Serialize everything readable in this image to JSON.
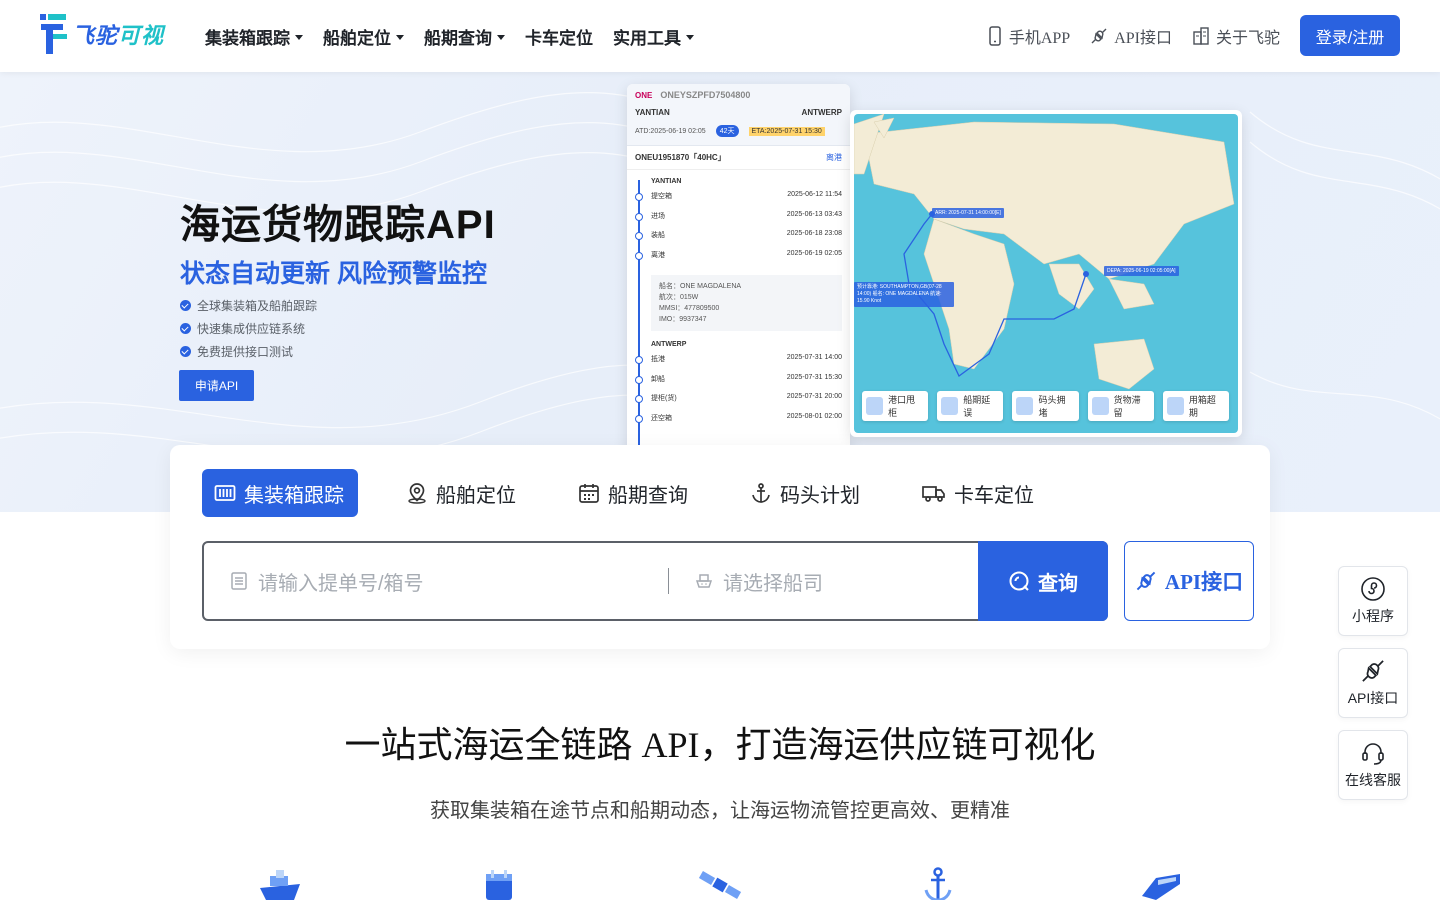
{
  "brand": {
    "logo_text_a": "飞驼",
    "logo_text_b": "可视"
  },
  "nav": {
    "items": [
      {
        "label": "集装箱跟踪",
        "dropdown": true
      },
      {
        "label": "船舶定位",
        "dropdown": true
      },
      {
        "label": "船期查询",
        "dropdown": true
      },
      {
        "label": "卡车定位",
        "dropdown": false
      },
      {
        "label": "实用工具",
        "dropdown": true
      }
    ],
    "right": [
      {
        "label": "手机APP",
        "icon": "phone-icon"
      },
      {
        "label": "API接口",
        "icon": "plug-icon"
      },
      {
        "label": "关于飞驼",
        "icon": "building-icon"
      }
    ],
    "login_label": "登录/注册"
  },
  "hero": {
    "title": "海运货物跟踪API",
    "subtitle": "状态自动更新 风险预警监控",
    "features": [
      "全球集装箱及船舶跟踪",
      "快速集成供应链系统",
      "免费提供接口测试"
    ],
    "apply_label": "申请API",
    "mock": {
      "carrier": "ONE",
      "bl_no": "ONEYSZPFD7504800",
      "origin": "YANTIAN",
      "destination": "ANTWERP",
      "atd": "ATD:2025-06-19 02:05",
      "days": "42天",
      "eta": "ETA:2025-07-31 15:30",
      "container": "ONEU1951870「40HC」",
      "container_status": "离港",
      "origin_events": [
        {
          "name": "提空箱",
          "time": "2025-06-12 11:54"
        },
        {
          "name": "进场",
          "time": "2025-06-13 03:43"
        },
        {
          "name": "装船",
          "time": "2025-06-18 23:08"
        },
        {
          "name": "离港",
          "time": "2025-06-19 02:05"
        }
      ],
      "vessel": [
        "船名：ONE MAGDALENA",
        "航次：015W",
        "MMSI：477809500",
        "IMO：9937347"
      ],
      "dest_events": [
        {
          "name": "抵港",
          "time": "2025-07-31 14:00"
        },
        {
          "name": "卸船",
          "time": "2025-07-31 15:30"
        },
        {
          "name": "提柜(货)",
          "time": "2025-07-31 20:00"
        },
        {
          "name": "还空箱",
          "time": "2025-08-01 02:00"
        }
      ],
      "map_labels": {
        "arr": "ARR: 2025-07-31 14:00:00[E]",
        "dep": "DEPA: 2025-06-19 02:05:00[A]",
        "current": "预计靠港: SOUTHAMPTON,GB(07-28 14:00) 船名: ONE MAGDALENA 航速: 15.90 Knot"
      },
      "map_tags": [
        "港口甩柜",
        "船期延误",
        "码头拥堵",
        "货物滞留",
        "用箱超期"
      ]
    }
  },
  "search": {
    "tabs": [
      {
        "label": "集装箱跟踪",
        "active": true
      },
      {
        "label": "船舶定位",
        "active": false
      },
      {
        "label": "船期查询",
        "active": false
      },
      {
        "label": "码头计划",
        "active": false
      },
      {
        "label": "卡车定位",
        "active": false
      }
    ],
    "input_placeholder": "请输入提单号/箱号",
    "carrier_placeholder": "请选择船司",
    "search_label": "查询",
    "api_label": "API接口"
  },
  "section": {
    "title": "一站式海运全链路 API，打造海运供应链可视化",
    "subtitle": "获取集装箱在途节点和船期动态，让海运物流管控更高效、更精准"
  },
  "floating": [
    {
      "label": "小程序",
      "icon": "mini-program-icon"
    },
    {
      "label": "API接口",
      "icon": "plug-icon"
    },
    {
      "label": "在线客服",
      "icon": "headset-icon"
    }
  ],
  "colors": {
    "primary": "#2a62e0",
    "accent": "#1fc1c8"
  }
}
